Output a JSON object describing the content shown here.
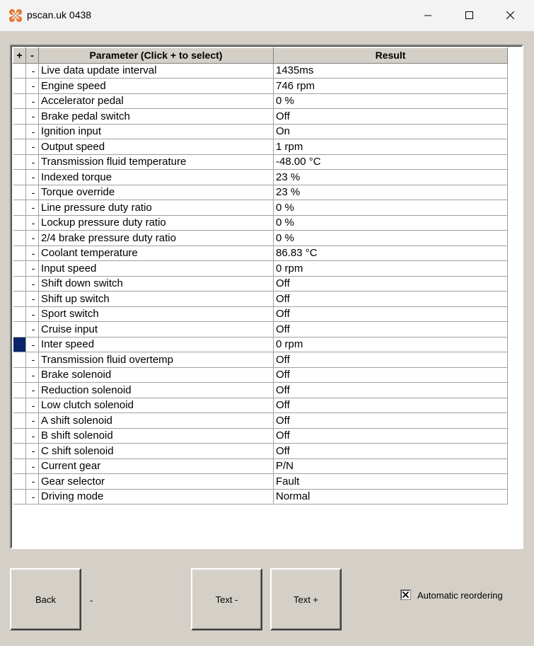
{
  "window": {
    "title": "pscan.uk 0438",
    "icon": "pscan-logo-icon",
    "controls": [
      "minimize-icon",
      "maximize-icon",
      "close-icon"
    ]
  },
  "grid": {
    "headers": {
      "plus": "+",
      "minus": "-",
      "parameter": "Parameter (Click + to select)",
      "result": "Result"
    },
    "rows": [
      {
        "minus": "-",
        "parameter": "Live data update interval",
        "result": "1435ms"
      },
      {
        "minus": "-",
        "parameter": "Engine speed",
        "result": "746 rpm"
      },
      {
        "minus": "-",
        "parameter": "Accelerator pedal",
        "result": "0 %"
      },
      {
        "minus": "-",
        "parameter": "Brake pedal switch",
        "result": "Off"
      },
      {
        "minus": "-",
        "parameter": "Ignition input",
        "result": "On"
      },
      {
        "minus": "-",
        "parameter": "Output speed",
        "result": "1 rpm"
      },
      {
        "minus": "-",
        "parameter": "Transmission fluid temperature",
        "result": "-48.00 °C"
      },
      {
        "minus": "-",
        "parameter": "Indexed torque",
        "result": "23 %"
      },
      {
        "minus": "-",
        "parameter": "Torque override",
        "result": "23 %"
      },
      {
        "minus": "-",
        "parameter": "Line pressure duty ratio",
        "result": "0 %"
      },
      {
        "minus": "-",
        "parameter": "Lockup pressure duty ratio",
        "result": "0 %"
      },
      {
        "minus": "-",
        "parameter": "2/4 brake pressure duty ratio",
        "result": "0 %"
      },
      {
        "minus": "-",
        "parameter": "Coolant temperature",
        "result": "86.83 °C"
      },
      {
        "minus": "-",
        "parameter": "Input speed",
        "result": "0 rpm"
      },
      {
        "minus": "-",
        "parameter": "Shift down switch",
        "result": "Off"
      },
      {
        "minus": "-",
        "parameter": "Shift up switch",
        "result": "Off"
      },
      {
        "minus": "-",
        "parameter": "Sport switch",
        "result": "Off"
      },
      {
        "minus": "-",
        "parameter": "Cruise input",
        "result": "Off"
      },
      {
        "minus": "-",
        "parameter": "Inter speed",
        "result": "0 rpm",
        "selected_marker": true
      },
      {
        "minus": "-",
        "parameter": "Transmission fluid overtemp",
        "result": "Off"
      },
      {
        "minus": "-",
        "parameter": "Brake solenoid",
        "result": "Off"
      },
      {
        "minus": "-",
        "parameter": "Reduction solenoid",
        "result": "Off"
      },
      {
        "minus": "-",
        "parameter": "Low clutch solenoid",
        "result": "Off"
      },
      {
        "minus": "-",
        "parameter": "A shift solenoid",
        "result": "Off"
      },
      {
        "minus": "-",
        "parameter": "B shift solenoid",
        "result": "Off"
      },
      {
        "minus": "-",
        "parameter": "C shift solenoid",
        "result": "Off"
      },
      {
        "minus": "-",
        "parameter": "Current gear",
        "result": "P/N"
      },
      {
        "minus": "-",
        "parameter": "Gear selector",
        "result": "Fault"
      },
      {
        "minus": "-",
        "parameter": "Driving mode",
        "result": "Normal"
      }
    ]
  },
  "footer": {
    "back_label": "Back",
    "status_text": "-",
    "text_minus_label": "Text -",
    "text_plus_label": "Text +",
    "auto_reorder_label": "Automatic reordering",
    "auto_reorder_checked": true
  },
  "colors": {
    "selection_marker": "#0a246a",
    "window_bg": "#d4d0c8"
  }
}
